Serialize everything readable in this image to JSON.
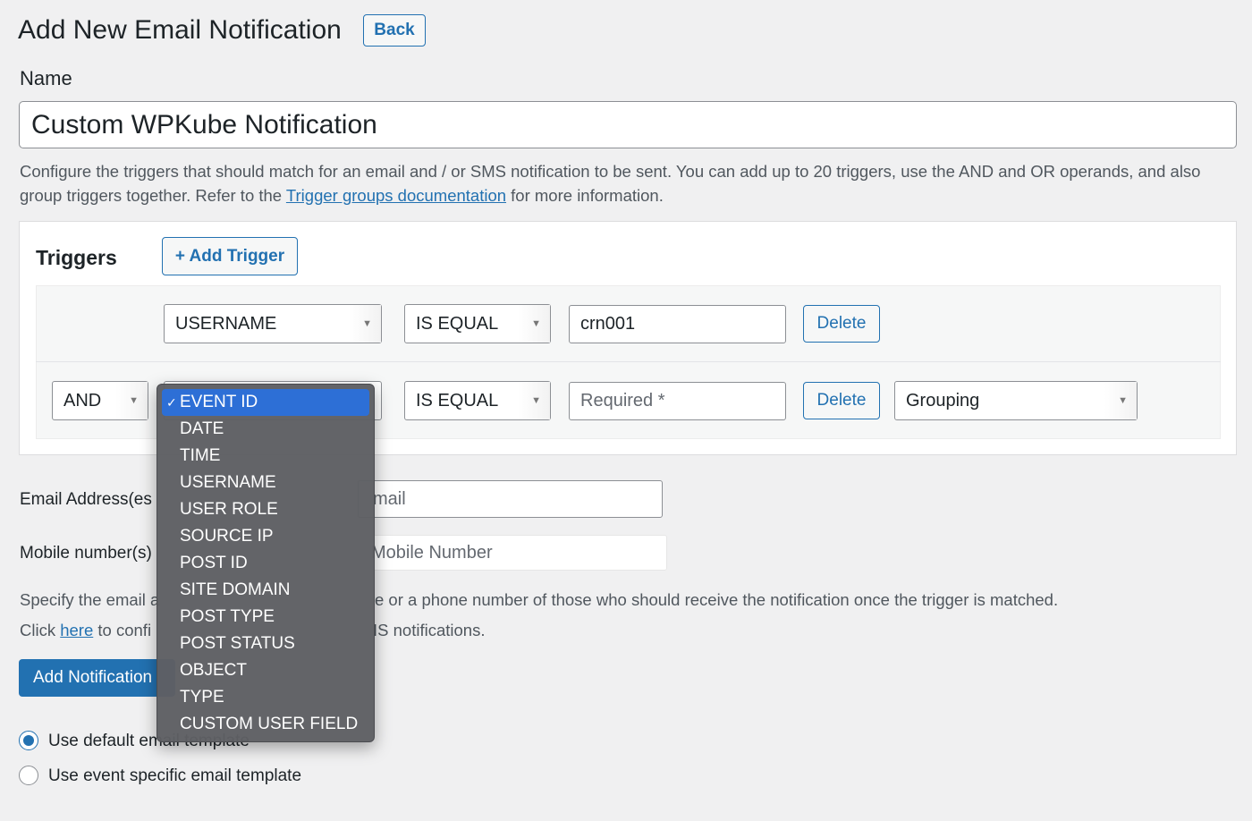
{
  "header": {
    "title": "Add New Email Notification",
    "back_label": "Back"
  },
  "name_field": {
    "label": "Name",
    "value": "Custom WPKube Notification"
  },
  "description": {
    "text_before": "Configure the triggers that should match for an email and / or SMS notification to be sent. You can add up to 20 triggers, use the AND and OR operands, and also group triggers together. Refer to the ",
    "link": "Trigger groups documentation",
    "text_after": " for more information."
  },
  "triggers": {
    "title": "Triggers",
    "add_label": "+ Add Trigger",
    "rows": [
      {
        "field": "USERNAME",
        "operator": "IS EQUAL",
        "value": "crn001",
        "delete": "Delete"
      },
      {
        "operand": "AND",
        "field": "EVENT ID",
        "operator": "IS EQUAL",
        "value_placeholder": "Required *",
        "delete": "Delete",
        "grouping": "Grouping"
      }
    ]
  },
  "field_dropdown": {
    "selected": "EVENT ID",
    "checkmark": "✓",
    "options": [
      "EVENT ID",
      "DATE",
      "TIME",
      "USERNAME",
      "USER ROLE",
      "SOURCE IP",
      "POST ID",
      "SITE DOMAIN",
      "POST TYPE",
      "POST STATUS",
      "OBJECT",
      "TYPE",
      "CUSTOM USER FIELD"
    ]
  },
  "recipients": {
    "email_label_visible": "Email Address(es",
    "email_placeholder_visible": "mail",
    "mobile_label_visible": "Mobile number(s)",
    "mobile_placeholder_visible": "Mobile Number",
    "help_line1_left": "Specify the email a",
    "help_line1_right": "e or a phone number of those who should receive the notification once the trigger is matched.",
    "help_line2_before": "Click ",
    "help_line2_link": "here",
    "help_line2_after": " to confi",
    "help_line2_right": "IS notifications."
  },
  "actions": {
    "add_notification_label": "Add Notification"
  },
  "template_options": [
    {
      "label": "Use default email template",
      "checked": true
    },
    {
      "label": "Use event specific email template",
      "checked": false
    }
  ],
  "colors": {
    "accent": "#2271b1",
    "dropdown_bg": "#5e5f63",
    "dropdown_selected": "#2d6fd6",
    "page_bg": "#f0f0f1"
  }
}
